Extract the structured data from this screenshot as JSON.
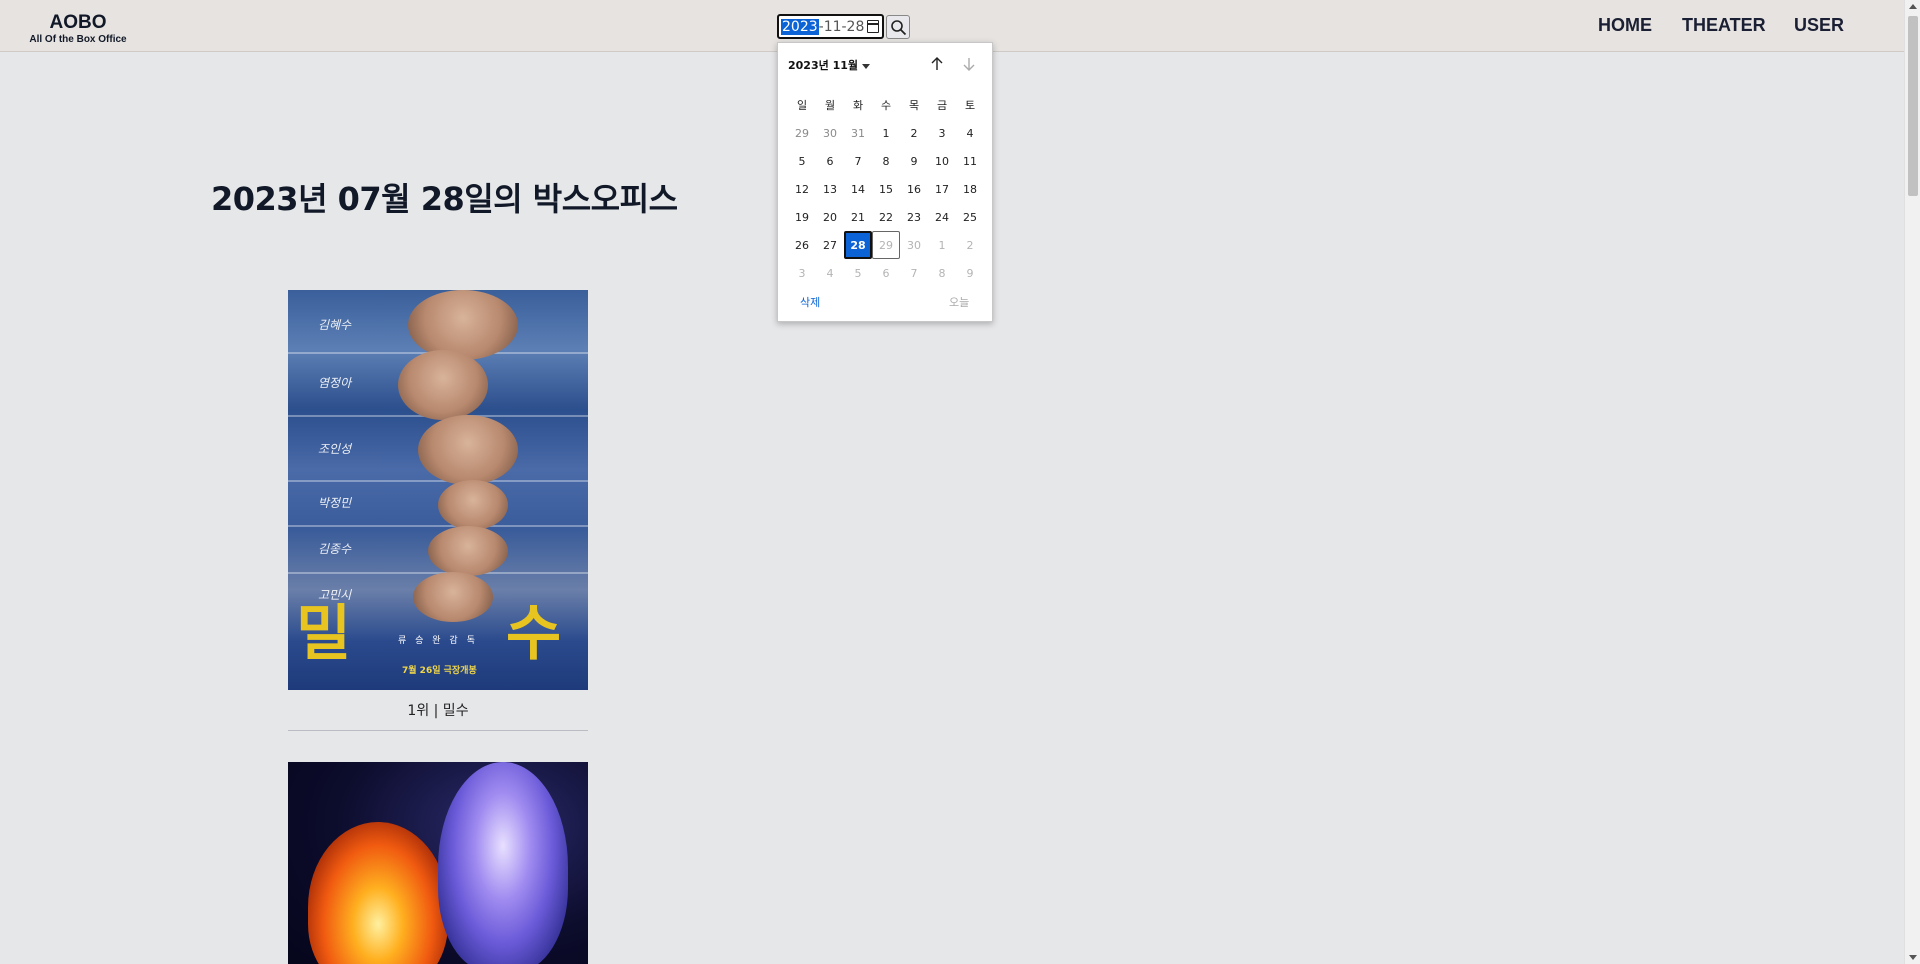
{
  "header": {
    "logo_title": "AOBO",
    "logo_subtitle": "All Of the Box Office",
    "nav": {
      "home": "HOME",
      "theater": "THEATER",
      "user": "USER"
    }
  },
  "search": {
    "date_year": "2023",
    "date_rest": "-11-28",
    "icon": "search-icon"
  },
  "calendar": {
    "month_label": "2023년 11월",
    "weekdays": [
      "일",
      "월",
      "화",
      "수",
      "목",
      "금",
      "토"
    ],
    "weeks": [
      [
        "29",
        "30",
        "31",
        "1",
        "2",
        "3",
        "4"
      ],
      [
        "5",
        "6",
        "7",
        "8",
        "9",
        "10",
        "11"
      ],
      [
        "12",
        "13",
        "14",
        "15",
        "16",
        "17",
        "18"
      ],
      [
        "19",
        "20",
        "21",
        "22",
        "23",
        "24",
        "25"
      ],
      [
        "26",
        "27",
        "28",
        "29",
        "30",
        "1",
        "2"
      ],
      [
        "3",
        "4",
        "5",
        "6",
        "7",
        "8",
        "9"
      ]
    ],
    "selected_day": "28",
    "clear_label": "삭제",
    "today_label": "오늘"
  },
  "main": {
    "title": "2023년 07월 28일의 박스오피스",
    "movies": [
      {
        "caption": "1위 | 밀수",
        "poster": {
          "cast": [
            "김혜수",
            "염정아",
            "조인성",
            "박정민",
            "김종수",
            "고민시"
          ],
          "title_left": "밀",
          "title_right": "수",
          "director": "류 승 완   감 독",
          "release": "7월 26일 극장개봉"
        }
      },
      {
        "caption": ""
      }
    ]
  },
  "colors": {
    "accent": "#0b63d6",
    "background": "#e6e7e9",
    "header_bg": "#e6e3e0"
  }
}
